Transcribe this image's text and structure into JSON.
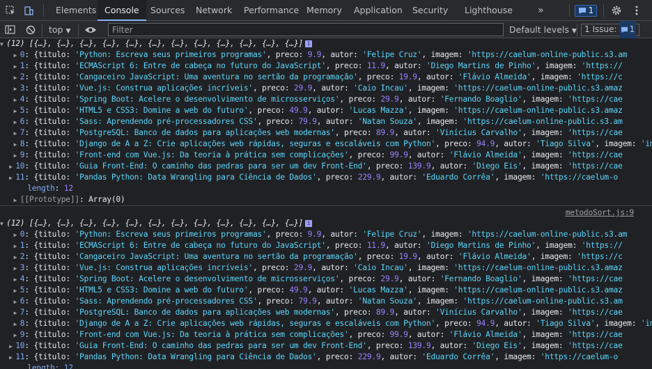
{
  "tabbar": {
    "tabs": [
      "Elements",
      "Console",
      "Sources",
      "Network",
      "Performance",
      "Memory",
      "Application",
      "Security",
      "Lighthouse"
    ],
    "more": "»",
    "issues_count": "1"
  },
  "toolbar": {
    "context": "top",
    "filter_placeholder": "Filter",
    "levels": "Default levels",
    "issue_label": "1 Issue:",
    "issue_count": "1"
  },
  "console": {
    "array_header": "(12) [{…}, {…}, {…}, {…}, {…}, {…}, {…}, {…}, {…}, {…}, {…}, {…}]",
    "info_badge": "i",
    "length_key": "length",
    "length_value": "12",
    "prototype_key": "[[Prototype]]",
    "prototype_value": "Array(0)",
    "source_link": "metodoSort.js:9",
    "items_first": [
      {
        "i": "0",
        "titulo": "'Python: Escreva seus primeiros programas'",
        "preco": "9.9",
        "autor": "'Felipe Cruz'",
        "imagem": "'https://caelum-online-public.s3.am"
      },
      {
        "i": "1",
        "titulo": "'ECMAScript 6: Entre de cabeça no futuro do JavaScript'",
        "preco": "11.9",
        "autor": "'Diego Martins de Pinho'",
        "imagem": "'https://"
      },
      {
        "i": "2",
        "titulo": "'Cangaceiro JavaScript: Uma aventura no sertão da programação'",
        "preco": "19.9",
        "autor": "'Flávio Almeida'",
        "imagem": "'https://c"
      },
      {
        "i": "3",
        "titulo": "'Vue.js: Construa aplicações incríveis'",
        "preco": "29.9",
        "autor": "'Caio Incau'",
        "imagem": "'https://caelum-online-public.s3.amaz"
      },
      {
        "i": "4",
        "titulo": "'Spring Boot: Acelere o desenvolvimento de microsserviços'",
        "preco": "29.9",
        "autor": "'Fernando Boaglio'",
        "imagem": "'https://cae"
      },
      {
        "i": "5",
        "titulo": "'HTML5 e CSS3: Domine a web do futuro'",
        "preco": "49.9",
        "autor": "'Lucas Mazza'",
        "imagem": "'https://caelum-online-public.s3.amaz"
      },
      {
        "i": "6",
        "titulo": "'Sass: Aprendendo pré-processadores CSS'",
        "preco": "79.9",
        "autor": "'Natan Souza'",
        "imagem": "'https://caelum-online-public.s3.am"
      },
      {
        "i": "7",
        "titulo": "'PostgreSQL: Banco de dados para aplicações web modernas'",
        "preco": "89.9",
        "autor": "'Vinícius Carvalho'",
        "imagem": "'https://cae"
      },
      {
        "i": "8",
        "titulo": "'Django de A a Z: Crie aplicações web rápidas, seguras e escaláveis com Python'",
        "preco": "94.9",
        "autor": "'Tiago Silva'",
        "imagem": "'imag"
      },
      {
        "i": "9",
        "titulo": "'Front-end com Vue.js: Da teoria à prática sem complicações'",
        "preco": "99.9",
        "autor": "'Flávio Almeida'",
        "imagem": "'https://cae"
      },
      {
        "i": "10",
        "titulo": "'Guia Front-End: O caminho das pedras para ser um dev Front-End'",
        "preco": "139.9",
        "autor": "'Diego Eis'",
        "imagem": "'https://cae"
      },
      {
        "i": "11",
        "titulo": "'Pandas Python: Data Wrangling para Ciência de Dados'",
        "preco": "229.9",
        "autor": "'Eduardo Corrêa'",
        "imagem": "'https://caelum-o"
      }
    ],
    "items_second": [
      {
        "i": "0",
        "titulo": "'Python: Escreva seus primeiros programas'",
        "preco": "9.9",
        "autor": "'Felipe Cruz'",
        "imagem": "'https://caelum-online-public.s3.am"
      },
      {
        "i": "1",
        "titulo": "'ECMAScript 6: Entre de cabeça no futuro do JavaScript'",
        "preco": "11.9",
        "autor": "'Diego Martins de Pinho'",
        "imagem": "'https://"
      },
      {
        "i": "2",
        "titulo": "'Cangaceiro JavaScript: Uma aventura no sertão da programação'",
        "preco": "19.9",
        "autor": "'Flávio Almeida'",
        "imagem": "'https://c"
      },
      {
        "i": "3",
        "titulo": "'Vue.js: Construa aplicações incríveis'",
        "preco": "29.9",
        "autor": "'Caio Incau'",
        "imagem": "'https://caelum-online-public.s3.amaz"
      },
      {
        "i": "4",
        "titulo": "'Spring Boot: Acelere o desenvolvimento de microsserviços'",
        "preco": "29.9",
        "autor": "'Fernando Boaglio'",
        "imagem": "'https://cae"
      },
      {
        "i": "5",
        "titulo": "'HTML5 e CSS3: Domine a web do futuro'",
        "preco": "49.9",
        "autor": "'Lucas Mazza'",
        "imagem": "'https://caelum-online-public.s3.amaz"
      },
      {
        "i": "6",
        "titulo": "'Sass: Aprendendo pré-processadores CSS'",
        "preco": "79.9",
        "autor": "'Natan Souza'",
        "imagem": "'https://caelum-online-public.s3.am"
      },
      {
        "i": "7",
        "titulo": "'PostgreSQL: Banco de dados para aplicações web modernas'",
        "preco": "89.9",
        "autor": "'Vinícius Carvalho'",
        "imagem": "'https://cae"
      },
      {
        "i": "8",
        "titulo": "'Django de A a Z: Crie aplicações web rápidas, seguras e escaláveis com Python'",
        "preco": "94.9",
        "autor": "'Tiago Silva'",
        "imagem": "'imag"
      },
      {
        "i": "9",
        "titulo": "'Front-end com Vue.js: Da teoria à prática sem complicações'",
        "preco": "99.9",
        "autor": "'Flávio Almeida'",
        "imagem": "'https://cae"
      },
      {
        "i": "10",
        "titulo": "'Guia Front-End: O caminho das pedras para ser um dev Front-End'",
        "preco": "139.9",
        "autor": "'Diego Eis'",
        "imagem": "'https://cae"
      },
      {
        "i": "11",
        "titulo": "'Pandas Python: Data Wrangling para Ciência de Dados'",
        "preco": "229.9",
        "autor": "'Eduardo Corrêa'",
        "imagem": "'https://caelum-o"
      }
    ],
    "trailing_length": "length: 12"
  },
  "colors": {
    "accent": "#8ab4f8",
    "key": "#7cacf8",
    "string": "#5cd5fb",
    "number": "#9980ff"
  }
}
